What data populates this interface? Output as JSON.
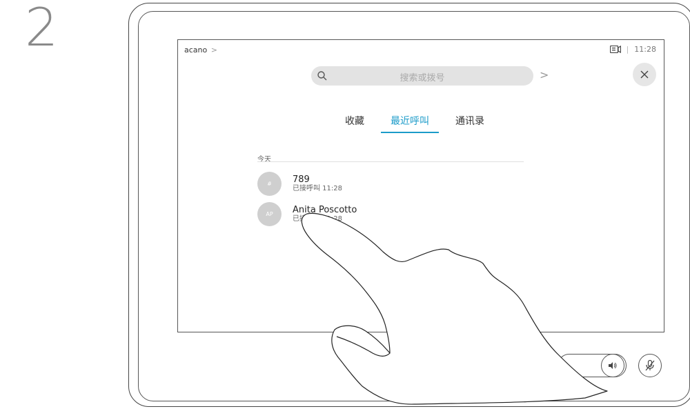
{
  "step": {
    "number": "2"
  },
  "header": {
    "breadcrumb": "acano",
    "breadcrumb_chevron": ">",
    "time": "11:28",
    "separator": "|"
  },
  "search": {
    "placeholder": "搜索或拨号",
    "go_chevron": ">"
  },
  "close": {
    "label": "×"
  },
  "tabs": [
    {
      "label": "收藏",
      "active": false
    },
    {
      "label": "最近呼叫",
      "active": true
    },
    {
      "label": "通讯录",
      "active": false
    }
  ],
  "recents": {
    "group_label": "今天",
    "items": [
      {
        "avatar": "#",
        "title": "789",
        "subtitle": "已接呼叫 11:28"
      },
      {
        "avatar": "AP",
        "title": "Anita Poscotto",
        "subtitle": "已接呼叫 11:28"
      }
    ]
  },
  "icons": {
    "camera": "camera-icon",
    "search": "search-icon",
    "close": "close-icon",
    "volume": "volume-icon",
    "mic_mute": "mic-mute-icon"
  },
  "colors": {
    "accent": "#1b9bc9"
  }
}
